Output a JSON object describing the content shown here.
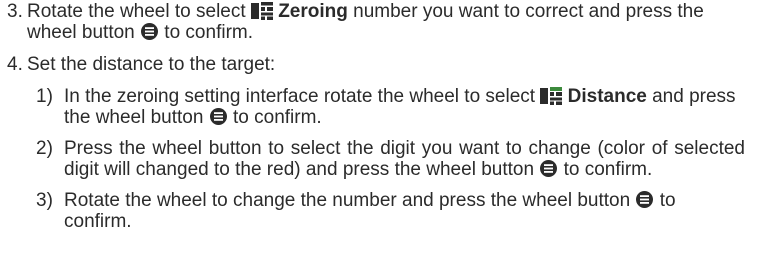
{
  "colors": {
    "text": "#2b2b2b",
    "icon": "#2b2b2b",
    "accent_green": "#3c8a3c"
  },
  "icons": {
    "zeroing": "zeroing-menu-icon",
    "distance": "distance-menu-icon",
    "wheel_button": "wheel-button-icon"
  },
  "step3": {
    "number": "3.",
    "part_a": "Rotate the wheel to select ",
    "bold": "Zeroing",
    "part_b": " number you want to correct and press the wheel button ",
    "part_c": " to confirm."
  },
  "step4": {
    "number": "4.",
    "text": "Set the distance to the target:",
    "sub": [
      {
        "number": "1)",
        "part_a": "In the zeroing setting interface rotate the wheel to select ",
        "bold": "Distance",
        "part_b": " and press the wheel button ",
        "part_c": " to confirm."
      },
      {
        "number": "2)",
        "part_a": "Press the wheel button to select the digit you want to change (color of selected digit will changed to the red) and press the wheel button ",
        "part_c": " to confirm."
      },
      {
        "number": "3)",
        "part_a": "Rotate the wheel to change the number and press the wheel button ",
        "part_c": " to confirm."
      }
    ]
  }
}
